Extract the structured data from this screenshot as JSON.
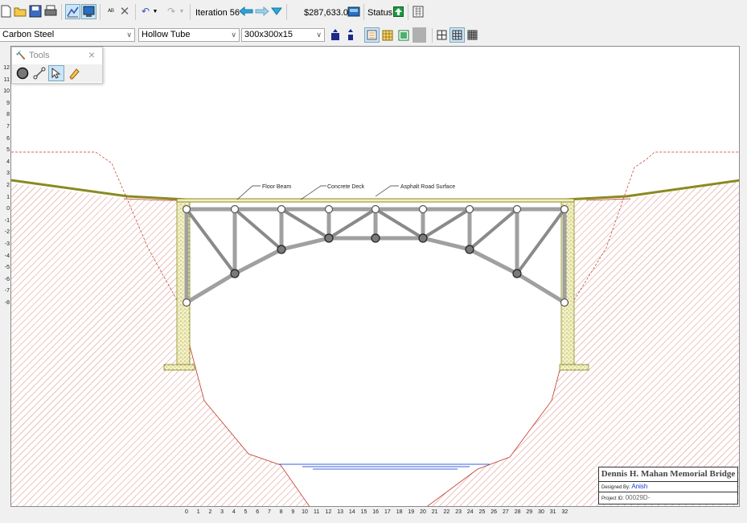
{
  "toolbar": {
    "iteration_label": "Iteration 56",
    "cost": "$287,633.01",
    "status_label": "Status:"
  },
  "selectors": {
    "material": "Carbon Steel",
    "section": "Hollow Tube",
    "size": "300x300x15"
  },
  "tools_palette": {
    "title": "Tools",
    "tools": [
      "joint-tool",
      "member-tool",
      "select-tool",
      "eraser-tool"
    ]
  },
  "drawing": {
    "labels": {
      "floor_beam": "Floor Beam",
      "concrete_deck": "Concrete Deck",
      "road_surface": "Asphalt Road Surface"
    },
    "y_ticks": [
      "12",
      "11",
      "10",
      "9",
      "8",
      "7",
      "6",
      "5",
      "4",
      "3",
      "2",
      "1",
      "0",
      "-1",
      "-2",
      "-3",
      "-4",
      "-5",
      "-6",
      "-7",
      "-8"
    ],
    "x_ticks": [
      "0",
      "1",
      "2",
      "3",
      "4",
      "5",
      "6",
      "7",
      "8",
      "9",
      "10",
      "11",
      "12",
      "13",
      "14",
      "15",
      "16",
      "17",
      "18",
      "19",
      "20",
      "21",
      "22",
      "23",
      "24",
      "25",
      "26",
      "27",
      "28",
      "29",
      "30",
      "31",
      "32"
    ]
  },
  "title_block": {
    "bridge_name": "Dennis H. Mahan Memorial Bridge",
    "designed_by_label": "Designed By:",
    "designer": "Anish",
    "project_id_label": "Project ID:",
    "project_id": "00029D-"
  },
  "colors": {
    "steel": "#a0a0a0",
    "terrain_hatch": "#c0392b",
    "deck": "#8a8a20",
    "water": "#3a5fe0"
  }
}
